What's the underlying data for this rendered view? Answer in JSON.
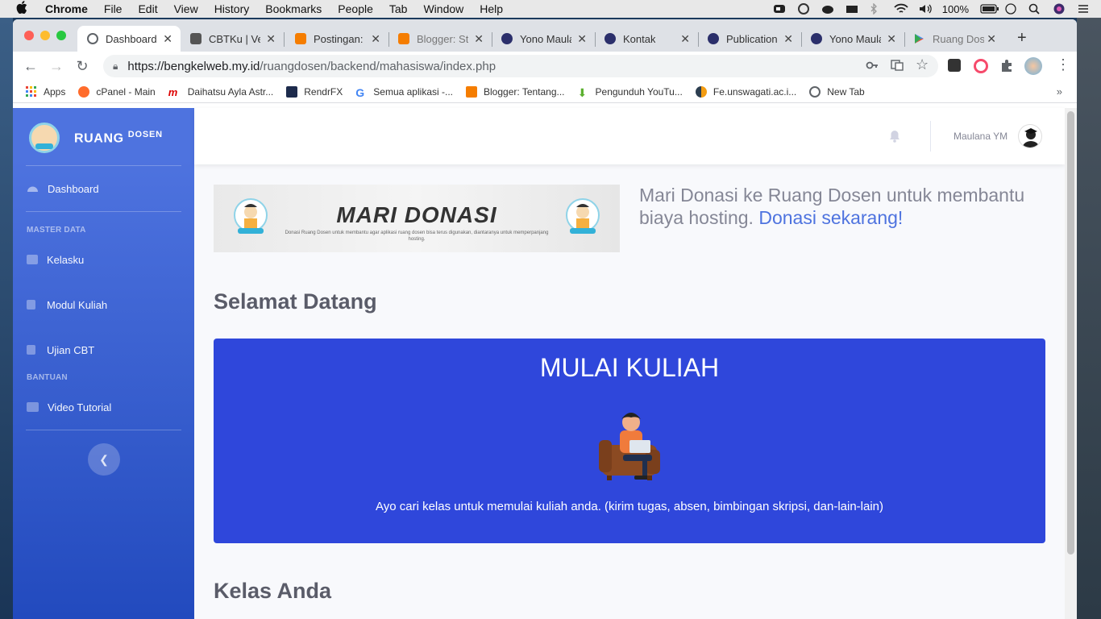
{
  "menubar": {
    "app": "Chrome",
    "items": [
      "File",
      "Edit",
      "View",
      "History",
      "Bookmarks",
      "People",
      "Tab",
      "Window",
      "Help"
    ],
    "battery": "100%"
  },
  "tabs": [
    {
      "title": "Dashboard",
      "active": true
    },
    {
      "title": "CBTKu | Ve"
    },
    {
      "title": "Postingan:"
    },
    {
      "title": "Blogger: St"
    },
    {
      "title": "Yono Maula"
    },
    {
      "title": "Kontak"
    },
    {
      "title": "Publication"
    },
    {
      "title": "Yono Maula"
    },
    {
      "title": "Ruang Dos"
    }
  ],
  "omnibox": {
    "host": "https://bengkelweb.my.id",
    "path": "/ruangdosen/backend/mahasiswa/index.php"
  },
  "bookmarks": [
    {
      "label": "Apps"
    },
    {
      "label": "cPanel - Main"
    },
    {
      "label": "Daihatsu Ayla Astr..."
    },
    {
      "label": "RendrFX"
    },
    {
      "label": "Semua aplikasi -..."
    },
    {
      "label": "Blogger: Tentang..."
    },
    {
      "label": "Pengunduh YouTu..."
    },
    {
      "label": "Fe.unswagati.ac.i..."
    },
    {
      "label": "New Tab"
    }
  ],
  "sidebar": {
    "brand_main": "RUANG",
    "brand_sup": "DOSEN",
    "dashboard": "Dashboard",
    "heading_master": "MASTER DATA",
    "kelasku": "Kelasku",
    "modul": "Modul Kuliah",
    "ujian": "Ujian CBT",
    "heading_bantuan": "BANTUAN",
    "video": "Video Tutorial"
  },
  "topbar": {
    "username": "Maulana YM"
  },
  "banner": {
    "title": "MARI DONASI",
    "subtitle": "Donasi Ruang Dosen untuk membantu agar aplikasi ruang dosen bisa terus digunakan, diantaranya untuk memperpanjang hosting."
  },
  "donasi": {
    "text": "Mari Donasi ke Ruang Dosen untuk membantu biaya hosting.",
    "link": "Donasi sekarang!"
  },
  "welcome_title": "Selamat Datang",
  "hero": {
    "title": "MULAI KULIAH",
    "description": "Ayo cari kelas untuk memulai kuliah anda. (kirim tugas, absen, bimbingan skripsi, dan-lain-lain)"
  },
  "classes_title": "Kelas Anda",
  "colors": {
    "sidebar": "#4e73df",
    "hero": "#2f47db",
    "link": "#4e73df"
  }
}
